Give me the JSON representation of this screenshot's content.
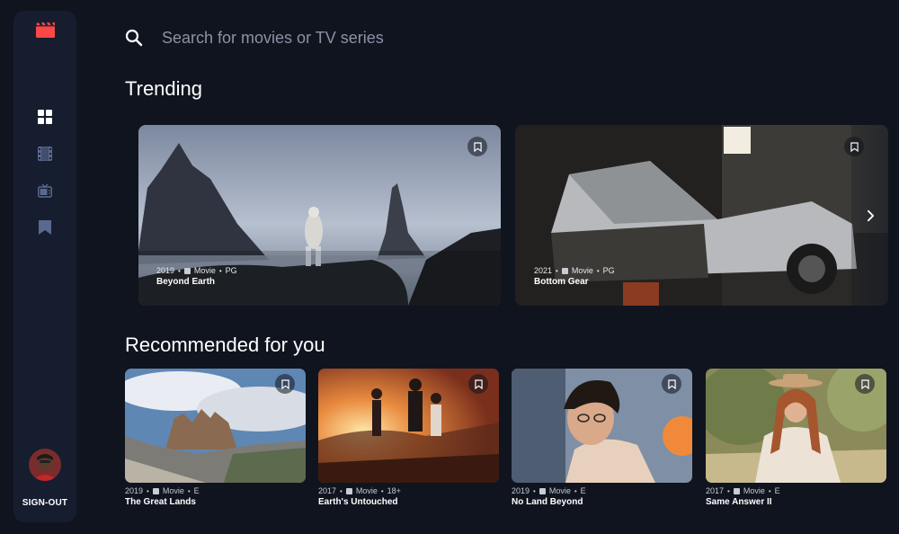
{
  "sidebar": {
    "nav": [
      {
        "icon": "home-grid-icon",
        "active": true
      },
      {
        "icon": "movies-film-icon",
        "active": false
      },
      {
        "icon": "tv-series-icon",
        "active": false
      },
      {
        "icon": "bookmark-icon",
        "active": false
      }
    ],
    "signout_label": "SIGN-OUT"
  },
  "search": {
    "placeholder": "Search for movies or TV series",
    "value": ""
  },
  "trending": {
    "title": "Trending",
    "items": [
      {
        "year": "2019",
        "category": "Movie",
        "rating": "PG",
        "title": "Beyond Earth"
      },
      {
        "year": "2021",
        "category": "Movie",
        "rating": "PG",
        "title": "Bottom Gear"
      }
    ]
  },
  "recommended": {
    "title": "Recommended for you",
    "items": [
      {
        "year": "2019",
        "category": "Movie",
        "rating": "E",
        "title": "The Great Lands"
      },
      {
        "year": "2017",
        "category": "Movie",
        "rating": "18+",
        "title": "Earth's Untouched"
      },
      {
        "year": "2019",
        "category": "Movie",
        "rating": "E",
        "title": "No Land Beyond"
      },
      {
        "year": "2017",
        "category": "Movie",
        "rating": "E",
        "title": "Same Answer II"
      }
    ]
  },
  "colors": {
    "background": "#10141e",
    "sidebar": "#161d2f",
    "accent": "#fc4747",
    "muted": "#5a698f"
  }
}
